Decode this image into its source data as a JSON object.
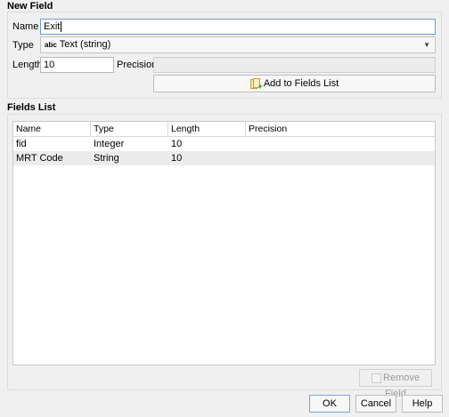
{
  "new_field": {
    "title": "New Field",
    "name_label": "Name",
    "name_value": "Exit",
    "type_label": "Type",
    "type_badge": "abc",
    "type_value": "Text (string)",
    "length_label": "Length",
    "length_value": "10",
    "precision_label": "Precision",
    "precision_value": "",
    "add_button": "Add to Fields List"
  },
  "fields_list": {
    "title": "Fields List",
    "columns": [
      "Name",
      "Type",
      "Length",
      "Precision"
    ],
    "rows": [
      {
        "name": "fid",
        "type": "Integer",
        "length": "10",
        "precision": ""
      },
      {
        "name": "MRT Code",
        "type": "String",
        "length": "10",
        "precision": ""
      }
    ],
    "remove_button": "Remove Field"
  },
  "dialog_buttons": {
    "ok": "OK",
    "cancel": "Cancel",
    "help": "Help"
  },
  "icons": {
    "add": "add-field-icon",
    "remove": "remove-field-icon",
    "dropdown": "chevron-down-icon"
  }
}
